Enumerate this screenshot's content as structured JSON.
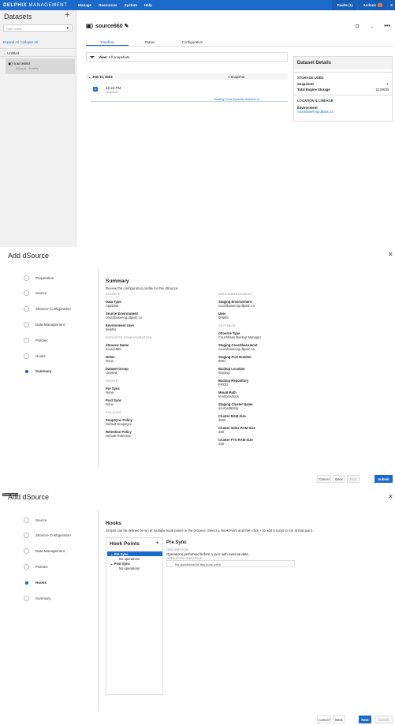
{
  "topbar": {
    "brand_bold": "DELPHIX",
    "brand_rest": " MANAGEMENT",
    "nav": [
      "Manage",
      "Resources",
      "System",
      "Help"
    ],
    "faults": "Faults (1)",
    "actions": "Actions",
    "user_initial": "S"
  },
  "sidebar": {
    "title": "Datasets",
    "filter_placeholder": "Filter name",
    "expand_all": "Expand All",
    "collapse_all": "Collapse All",
    "group": "Untitled",
    "item_name": "source660",
    "item_sub": "dSource · Healthy"
  },
  "main": {
    "title": "source660",
    "tabs": [
      "Timeflow",
      "Status",
      "Configuration"
    ],
    "view_label": "View:",
    "view_value": "All snapshots",
    "date": "JAN 10, 2023",
    "snapshot_count": "1 Snapshot",
    "snap_time": "12:23 PM",
    "snap_type": "Snapshot",
    "starting_point": "Starting Point (episode-timeflow-1)"
  },
  "details": {
    "title": "Dataset Details",
    "storage_header": "STORAGE USED",
    "snapshots_label": "Snapshots",
    "snapshots_value": "1",
    "total_label": "Total Engine Storage",
    "total_value": "21.89GB",
    "lineage_header": "LOCATION & LINEAGE",
    "env_label": "Environment",
    "env_value": "couchbaseeng.dlpxdc.co"
  },
  "summary_dialog": {
    "title": "Add dSource",
    "steps": [
      "Preparation",
      "Source",
      "dSource Configuration",
      "Data Management",
      "Policies",
      "Hooks",
      "Summary"
    ],
    "heading": "Summary",
    "desc": "Review the configuration profile for this dSource.",
    "left": [
      {
        "h": "SOURCE"
      },
      {
        "k": "Data Type",
        "v": "AppData"
      },
      {
        "k": "Source Environment",
        "v": "couchbaseeng.dlpxdc.co"
      },
      {
        "k": "Environment User",
        "v": "delphix"
      },
      {
        "h": "DSOURCE CONFIGURATION"
      },
      {
        "k": "dSource Name",
        "v": "source660"
      },
      {
        "k": "Notes",
        "v": "None"
      },
      {
        "k": "Dataset Group",
        "v": "Untitled"
      },
      {
        "h": "HOOKS"
      },
      {
        "k": "Pre Sync",
        "v": "None"
      },
      {
        "k": "Post Sync",
        "v": "None"
      },
      {
        "h": "POLICIES"
      },
      {
        "k": "SnapSync Policy",
        "v": "Default SnapSync"
      },
      {
        "k": "Retention Policy",
        "v": "Default Retention"
      }
    ],
    "right": [
      {
        "h": "DATA MANAGEMENT"
      },
      {
        "k": "Staging Environment",
        "v": "couchbaseeng.dlpxdc.co"
      },
      {
        "k": "User",
        "v": "delphix"
      },
      {
        "h": "SETTINGS"
      },
      {
        "k": "dSource Type",
        "v": "Couchbase Backup Manager"
      },
      {
        "k": "Staging Couchbase Host",
        "v": "couchbaseeng.dlpxdc.co"
      },
      {
        "k": "Staging Port Number",
        "v": "8091"
      },
      {
        "k": "Backup Location",
        "v": "/backup"
      },
      {
        "k": "Backup Repository",
        "v": "PROD"
      },
      {
        "k": "Mount Path",
        "v": "/mnt/provision"
      },
      {
        "k": "Staging Cluster Name",
        "v": "source660stg"
      },
      {
        "k": "Cluster RAM Size",
        "v": "2000"
      },
      {
        "k": "Cluster Index RAM Size",
        "v": "256"
      },
      {
        "k": "Cluster FTS RAM Size",
        "v": "256"
      }
    ],
    "buttons": [
      "Cancel",
      "Back",
      "Next",
      "Submit"
    ]
  },
  "hooks_dialog": {
    "title": "Add dSource",
    "tag": "Show query",
    "steps": [
      "Source",
      "dSource Configuration",
      "Data Management",
      "Policies",
      "Hooks",
      "Summary"
    ],
    "heading": "Hooks",
    "desc": "Scripts can be defined to run at multiple hook points in the process. Select a Hook Point and then click + to add a script to run at that point.",
    "hook_points_title": "Hook Points",
    "pre_sync": "Pre Sync",
    "pre_ops": "No operations",
    "post_sync": "Post Sync",
    "post_ops": "No operations",
    "detail_title": "Pre Sync",
    "description_h": "DESCRIPTION",
    "description": "Operations performed before a sync with external data.",
    "ordering_h": "OPERATION ORDERING",
    "no_ops": "No operations for this hook point.",
    "buttons": [
      "Cancel",
      "Back",
      "Next",
      "Submit"
    ]
  }
}
